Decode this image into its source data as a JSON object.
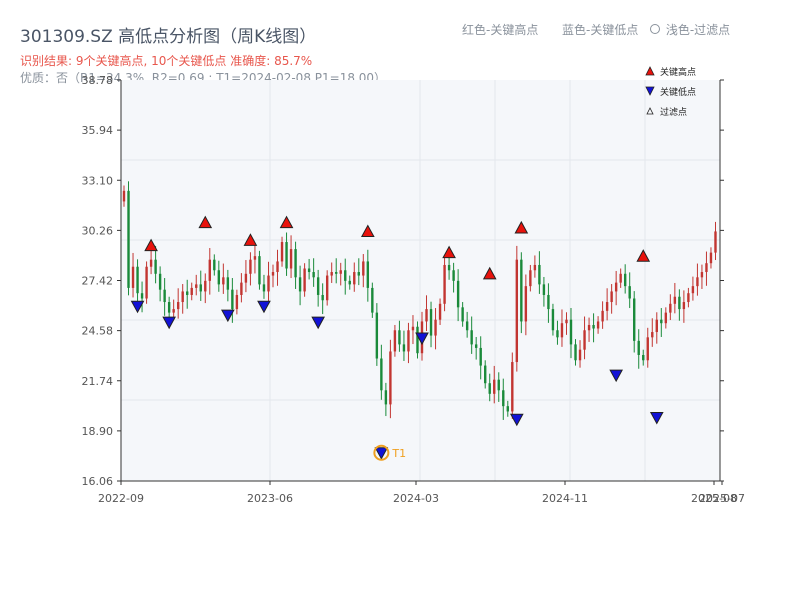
{
  "header": {
    "title": "301309.SZ 高低点分析图（周K线图）",
    "result": "识别结果: 9个关键高点, 10个关键低点  准确度: 85.7%",
    "quality": "优质：否（R1=34.3%, R2=0.69 ; T1=2024-02-08 P1=18.00）"
  },
  "top_legend": {
    "high": "红色-关键高点",
    "low": "蓝色-关键低点",
    "filtered": "浅色-过滤点"
  },
  "colors": {
    "up": "#c23531",
    "down": "#1a8a3a",
    "high_marker": "#e8120c",
    "low_marker": "#1212d6",
    "t1_marker": "#f0a020",
    "plot_bg": "#f5f7fa",
    "grid": "#e4e7ec"
  },
  "chart_data": {
    "type": "candlestick",
    "title": "301309.SZ 高低点分析图（周K线图）",
    "x_ticks": [
      "2022-09",
      "2023-06",
      "2024-03",
      "2024-11",
      "2025-07",
      "2025-08"
    ],
    "y_ticks": [
      "16.06",
      "18.90",
      "21.74",
      "24.58",
      "27.42",
      "30.26",
      "33.10",
      "35.94",
      "38.78"
    ],
    "ylim": [
      16.06,
      38.78
    ],
    "grid": true,
    "legend_position": "top-right",
    "legend": [
      {
        "label": "关键高点",
        "symbol": "triangle-up",
        "color": "#e8120c"
      },
      {
        "label": "关键低点",
        "symbol": "triangle-down",
        "color": "#1212d6"
      },
      {
        "label": "过滤点",
        "symbol": "triangle-up-outline",
        "color": "#222222"
      }
    ],
    "t1_label": "T1",
    "closes": [
      32.5,
      27.0,
      28.2,
      26.7,
      26.4,
      28.2,
      28.6,
      27.8,
      26.9,
      26.2,
      25.6,
      25.8,
      26.2,
      26.8,
      26.6,
      27.0,
      27.2,
      26.8,
      27.4,
      28.6,
      28.0,
      27.2,
      27.6,
      26.9,
      25.8,
      26.6,
      27.3,
      27.8,
      28.6,
      28.8,
      27.2,
      26.8,
      27.7,
      27.9,
      28.5,
      29.6,
      28.1,
      29.2,
      27.6,
      26.8,
      28.1,
      27.9,
      27.6,
      26.6,
      26.3,
      27.7,
      27.9,
      27.8,
      28.0,
      27.4,
      27.2,
      27.9,
      27.7,
      28.5,
      27.0,
      25.6,
      23.0,
      21.2,
      20.4,
      23.4,
      24.6,
      23.8,
      23.4,
      24.6,
      24.8,
      23.3,
      25.1,
      25.8,
      24.3,
      25.2,
      26.1,
      28.3,
      28.0,
      27.4,
      25.9,
      25.1,
      24.6,
      23.8,
      23.6,
      22.6,
      21.6,
      21.0,
      21.8,
      21.2,
      20.3,
      20.0,
      22.8,
      28.6,
      25.1,
      27.1,
      28.0,
      28.3,
      27.2,
      26.6,
      25.8,
      24.6,
      24.2,
      25.0,
      25.2,
      23.8,
      22.9,
      23.5,
      24.6,
      24.9,
      24.7,
      25.1,
      25.7,
      26.2,
      26.8,
      27.3,
      27.8,
      27.1,
      26.4,
      24.0,
      23.2,
      22.9,
      24.2,
      24.5,
      25.2,
      25.0,
      25.6,
      26.1,
      26.5,
      25.8,
      26.2,
      26.7,
      27.1,
      27.6,
      27.9,
      28.4,
      29.0,
      30.2
    ],
    "key_highs": [
      {
        "i": 6,
        "price": 29.0
      },
      {
        "i": 18,
        "price": 30.3
      },
      {
        "i": 28,
        "price": 29.3
      },
      {
        "i": 36,
        "price": 30.3
      },
      {
        "i": 54,
        "price": 29.8
      },
      {
        "i": 72,
        "price": 28.6
      },
      {
        "i": 81,
        "price": 27.4
      },
      {
        "i": 88,
        "price": 30.0
      },
      {
        "i": 115,
        "price": 28.4
      }
    ],
    "key_lows": [
      {
        "i": 3,
        "price": 26.3
      },
      {
        "i": 10,
        "price": 25.4
      },
      {
        "i": 23,
        "price": 25.8
      },
      {
        "i": 31,
        "price": 26.3
      },
      {
        "i": 43,
        "price": 25.4
      },
      {
        "i": 57,
        "price": 18.0
      },
      {
        "i": 66,
        "price": 24.5
      },
      {
        "i": 87,
        "price": 19.9
      },
      {
        "i": 109,
        "price": 22.4
      },
      {
        "i": 118,
        "price": 20.0
      }
    ],
    "t1_index": 57
  }
}
